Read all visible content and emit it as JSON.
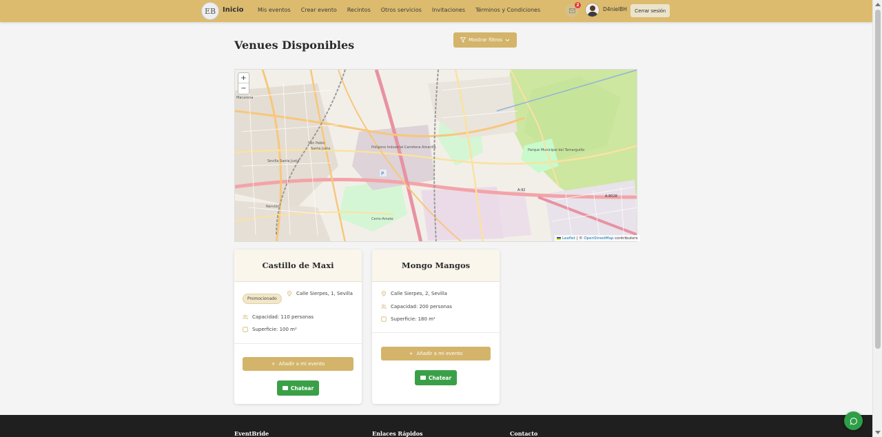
{
  "navbar": {
    "logo_text": "EB",
    "brand": "Inicio",
    "links": [
      "Mis eventos",
      "Crear evento",
      "Recintos",
      "Otros servicios",
      "Invitaciones",
      "Términos y Condiciones"
    ],
    "notification_count": "2",
    "username": "D4nielBH",
    "logout_label": "Cerrar sesión"
  },
  "page": {
    "title": "Venues Disponibles",
    "filter_button": "Mostrar filtros"
  },
  "map": {
    "zoom_in": "+",
    "zoom_out": "−",
    "attribution": {
      "leaflet": "Leaflet",
      "separator": " | © ",
      "osm": "OpenStreetMap",
      "suffix": " contributors"
    },
    "labels": [
      "Macarena",
      "San Pablo",
      "Santa Justa",
      "Polígono Industrial Carretera Amarilla",
      "Parque Municipal del Tamarguillo",
      "Nervión",
      "Cerro-Amate",
      "A-92",
      "A-8028",
      "Sevilla Santa Justa"
    ],
    "colors": {
      "land": "#f2efe9",
      "park": "#c8facc",
      "road": "#f7c77b",
      "motorway": "#e892a2",
      "rail": "#9a9a9a",
      "industrial": "#ebdbe8",
      "field": "#cde6a0"
    }
  },
  "venues": [
    {
      "name": "Castillo de Maxi",
      "badge": "Promocionado",
      "address": "Calle Sierpes, 1, Sevilla",
      "capacity": "Capacidad: 110 personas",
      "surface": "Superficie: 100 m²",
      "add_label": "Añadir a mi evento",
      "chat_label": "Chatear"
    },
    {
      "name": "Mongo Mangos",
      "address": "Calle Sierpes, 2, Sevilla",
      "capacity": "Capacidad: 200 personas",
      "surface": "Superficie: 180 m²",
      "add_label": "Añadir a mi evento",
      "chat_label": "Chatear"
    }
  ],
  "footer": {
    "columns": [
      "EventBride",
      "Enlaces Rápidos",
      "Contacto"
    ]
  },
  "theme": {
    "accent": "#d3b46a",
    "navbar": "#dcbb6e",
    "chat_green": "#3aa047",
    "footer": "#1f1f1f"
  }
}
